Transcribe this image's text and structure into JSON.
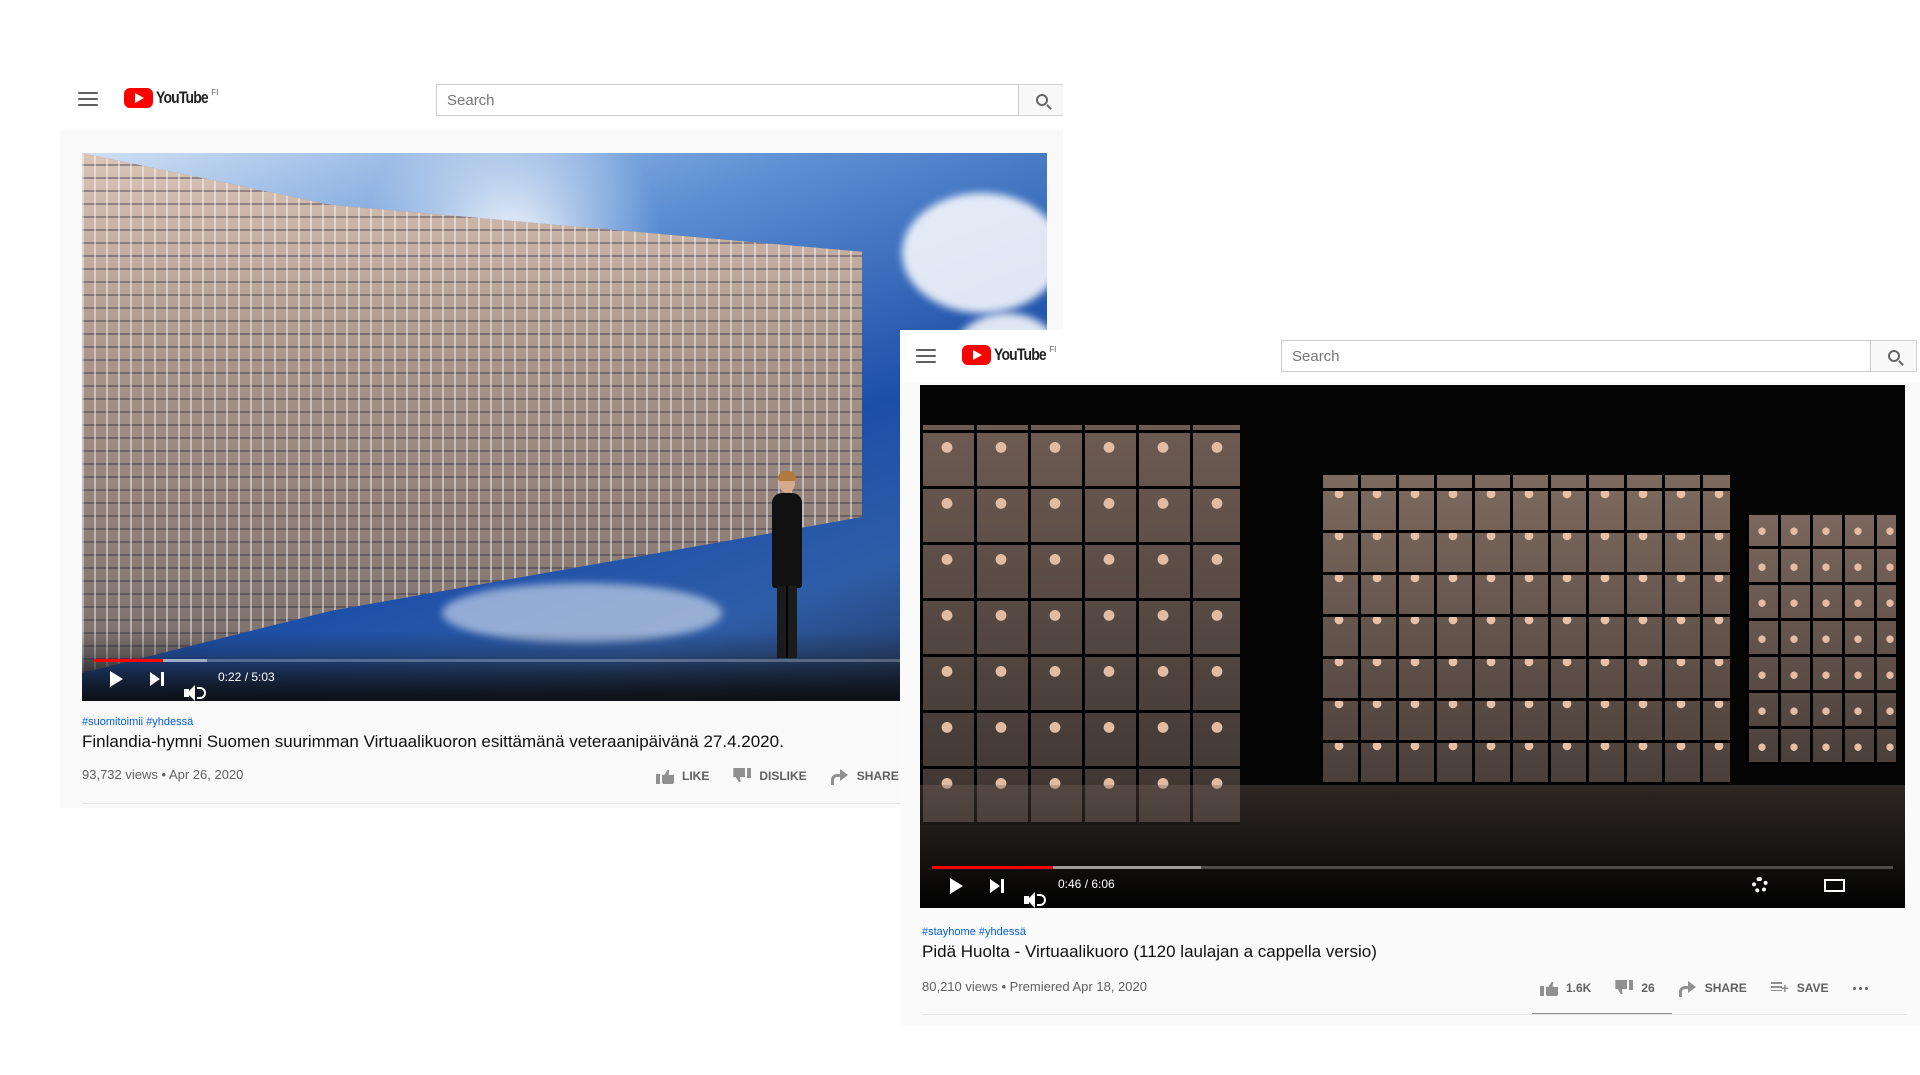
{
  "window1": {
    "logo_text": "YouTube",
    "logo_region": "FI",
    "search": {
      "placeholder": "Search"
    },
    "player": {
      "current_time": "0:22 / 5:03",
      "progress_fraction": 0.073,
      "buffer_fraction": 0.12
    },
    "hashtags": "#suomitoimii #yhdessä",
    "title": "Finlandia-hymni Suomen suurimman Virtuaalikuoron esittämänä veteraanipäivänä 27.4.2020.",
    "meta": "93,732 views • Apr 26, 2020",
    "actions": {
      "like": "LIKE",
      "dislike": "DISLIKE",
      "share": "SHARE"
    }
  },
  "window2": {
    "logo_text": "YouTube",
    "logo_region": "FI",
    "search": {
      "placeholder": "Search"
    },
    "player": {
      "current_time": "0:46 / 6:06",
      "progress_fraction": 0.126,
      "buffer_fraction": 0.28
    },
    "hashtags": "#stayhome #yhdessä",
    "title": "Pidä Huolta - Virtuaalikuoro (1120 laulajan a cappella versio)",
    "meta": "80,210 views • Premiered Apr 18, 2020",
    "actions": {
      "like": "1.6K",
      "dislike": "26",
      "share": "SHARE",
      "save": "SAVE"
    }
  },
  "colors": {
    "brand_red": "#ff0000",
    "hashtag_blue": "#065fd4",
    "meta_gray": "#606060"
  }
}
